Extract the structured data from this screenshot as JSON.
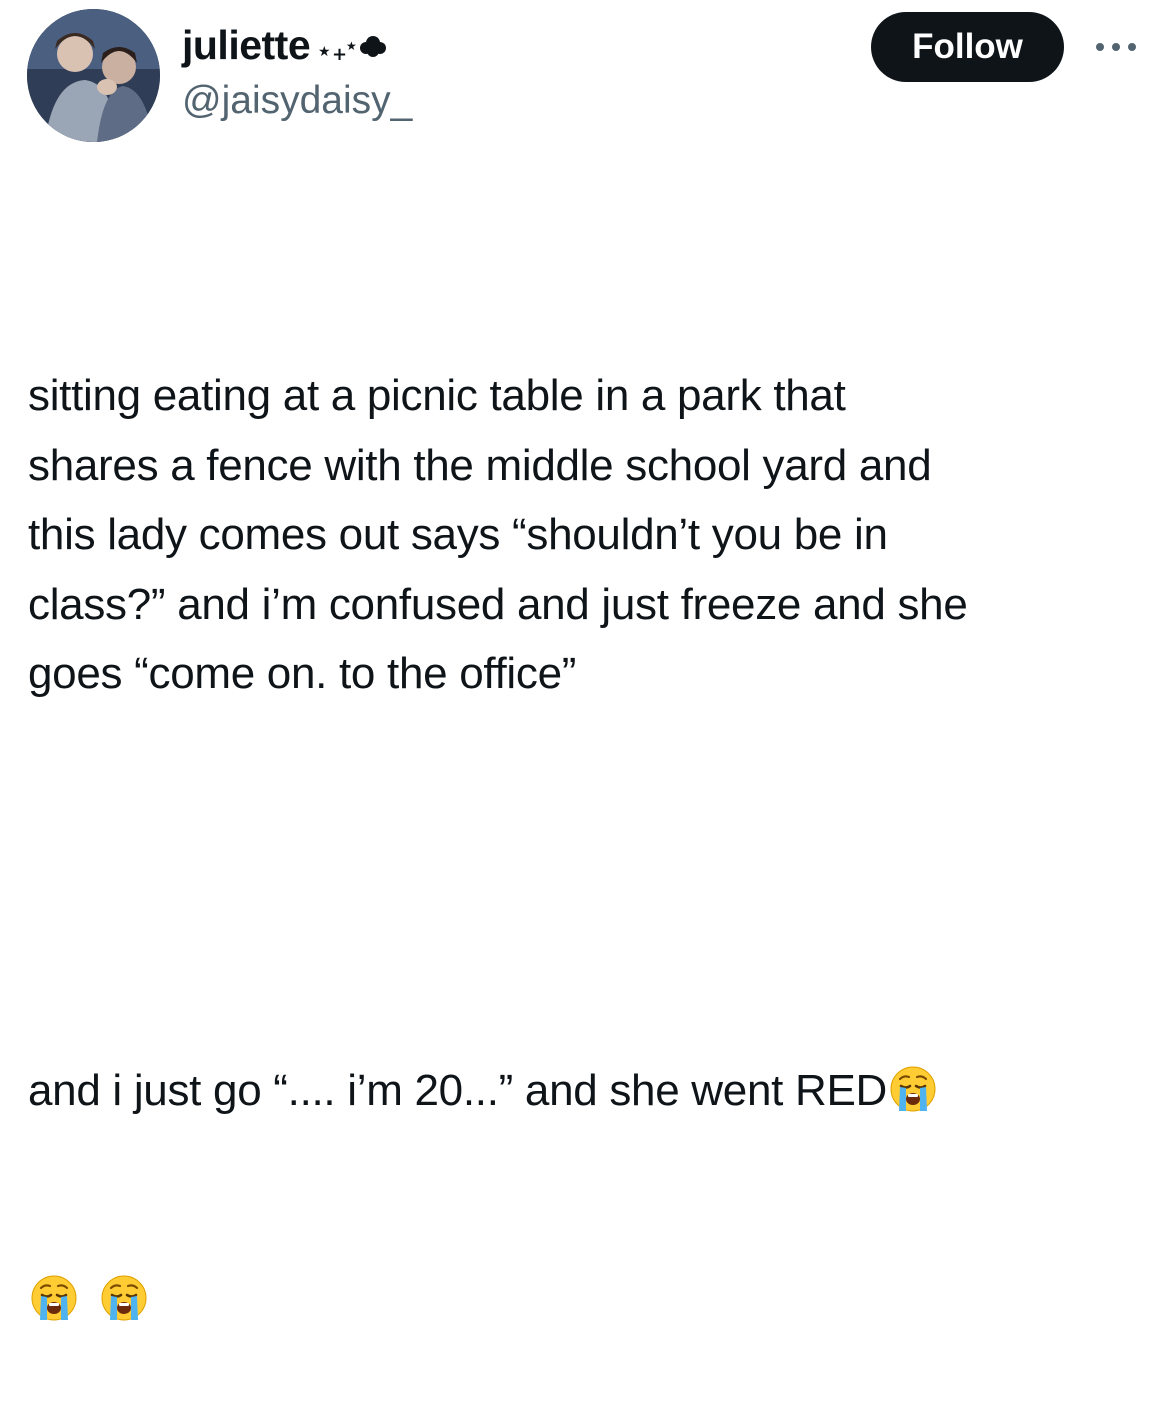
{
  "author": {
    "display_name": "juliette",
    "name_decoration_icons": [
      "star-icon",
      "plus-icon",
      "star-icon",
      "cloud-icon"
    ],
    "handle": "@jaisydaisy_",
    "avatar": "avatar-photo"
  },
  "actions": {
    "follow_label": "Follow",
    "more_icon": "more-dots-icon"
  },
  "tweet": {
    "paragraph_1": "sitting eating at a picnic table in a park that\nshares a fence with the middle school yard and\nthis lady comes out says “shouldn’t you be in\nclass?” and i’m confused and just freeze and she\ngoes “come on. to the office”",
    "paragraph_2": "and i just go “.... i’m 20...” and she went RED",
    "emojis": [
      "loudly-crying-face-icon",
      "loudly-crying-face-icon",
      "loudly-crying-face-icon"
    ]
  },
  "colors": {
    "text": "#0f1419",
    "secondary_text": "#536471",
    "follow_button_bg": "#0f1419",
    "follow_button_text": "#ffffff"
  }
}
